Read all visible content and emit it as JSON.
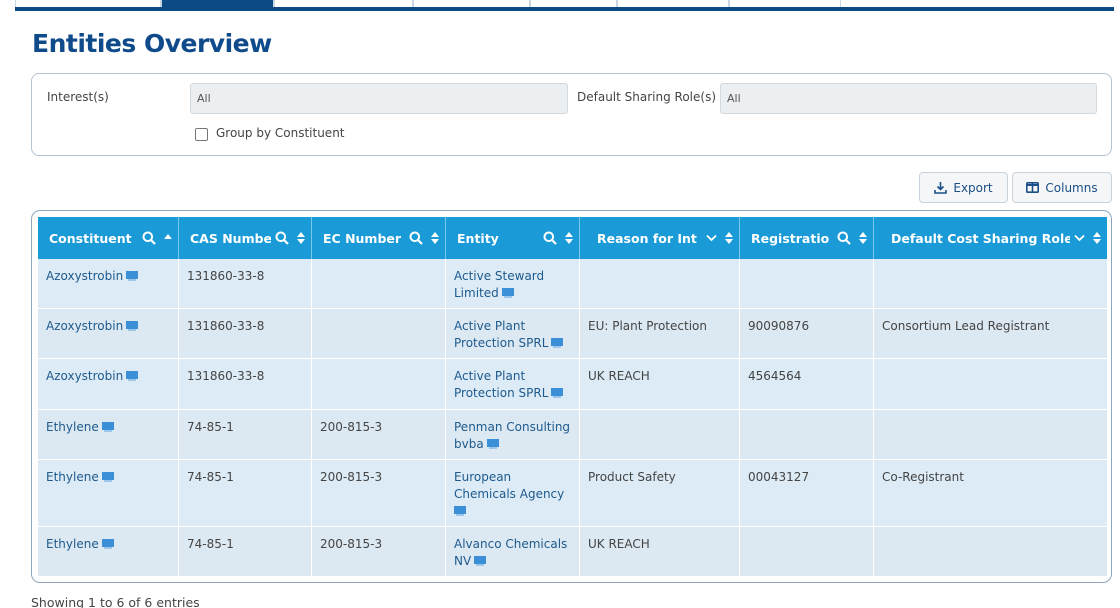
{
  "page": {
    "title": "Entities Overview"
  },
  "filters": {
    "interest_label": "Interest(s)",
    "interest_value": "All",
    "sharing_role_label": "Default Sharing Role(s)",
    "sharing_role_value": "All",
    "group_by_label": "Group by Constituent",
    "group_by_checked": false
  },
  "toolbar": {
    "export_label": "Export",
    "columns_label": "Columns"
  },
  "table": {
    "headers": [
      "Constituent",
      "CAS Numbe",
      "EC Number",
      "Entity",
      "Reason for Int ",
      "Registratio",
      "Default Cost Sharing Role"
    ],
    "rows": [
      {
        "constituent": "Azoxystrobin",
        "cas": "131860-33-8",
        "ec": "",
        "entity_l1": "Active Steward",
        "entity_l2": "Limited",
        "reason": "",
        "registration": "",
        "role": ""
      },
      {
        "constituent": "Azoxystrobin",
        "cas": "131860-33-8",
        "ec": "",
        "entity_l1": "Active Plant",
        "entity_l2": "Protection SPRL",
        "reason": "EU: Plant Protection",
        "registration": "90090876",
        "role": "Consortium Lead Registrant"
      },
      {
        "constituent": "Azoxystrobin",
        "cas": "131860-33-8",
        "ec": "",
        "entity_l1": "Active Plant",
        "entity_l2": "Protection SPRL",
        "reason": "UK REACH",
        "registration": "4564564",
        "role": ""
      },
      {
        "constituent": "Ethylene",
        "cas": "74-85-1",
        "ec": "200-815-3",
        "entity_l1": "Penman Consulting",
        "entity_l2": "bvba",
        "reason": "",
        "registration": "",
        "role": ""
      },
      {
        "constituent": "Ethylene",
        "cas": "74-85-1",
        "ec": "200-815-3",
        "entity_l1": "European",
        "entity_l2": "Chemicals Agency",
        "reason": "Product Safety",
        "registration": "00043127",
        "role": "Co-Registrant"
      },
      {
        "constituent": "Ethylene",
        "cas": "74-85-1",
        "ec": "200-815-3",
        "entity_l1": "Alvanco Chemicals",
        "entity_l2": "NV",
        "reason": "UK REACH",
        "registration": "",
        "role": ""
      }
    ]
  },
  "footer": {
    "info": "Showing 1 to 6 of 6 entries"
  },
  "colors": {
    "header_bg": "#1a9ad6",
    "title": "#0f4a8a",
    "nav": "#0c4a86",
    "row_bg": "#dcebf5"
  }
}
